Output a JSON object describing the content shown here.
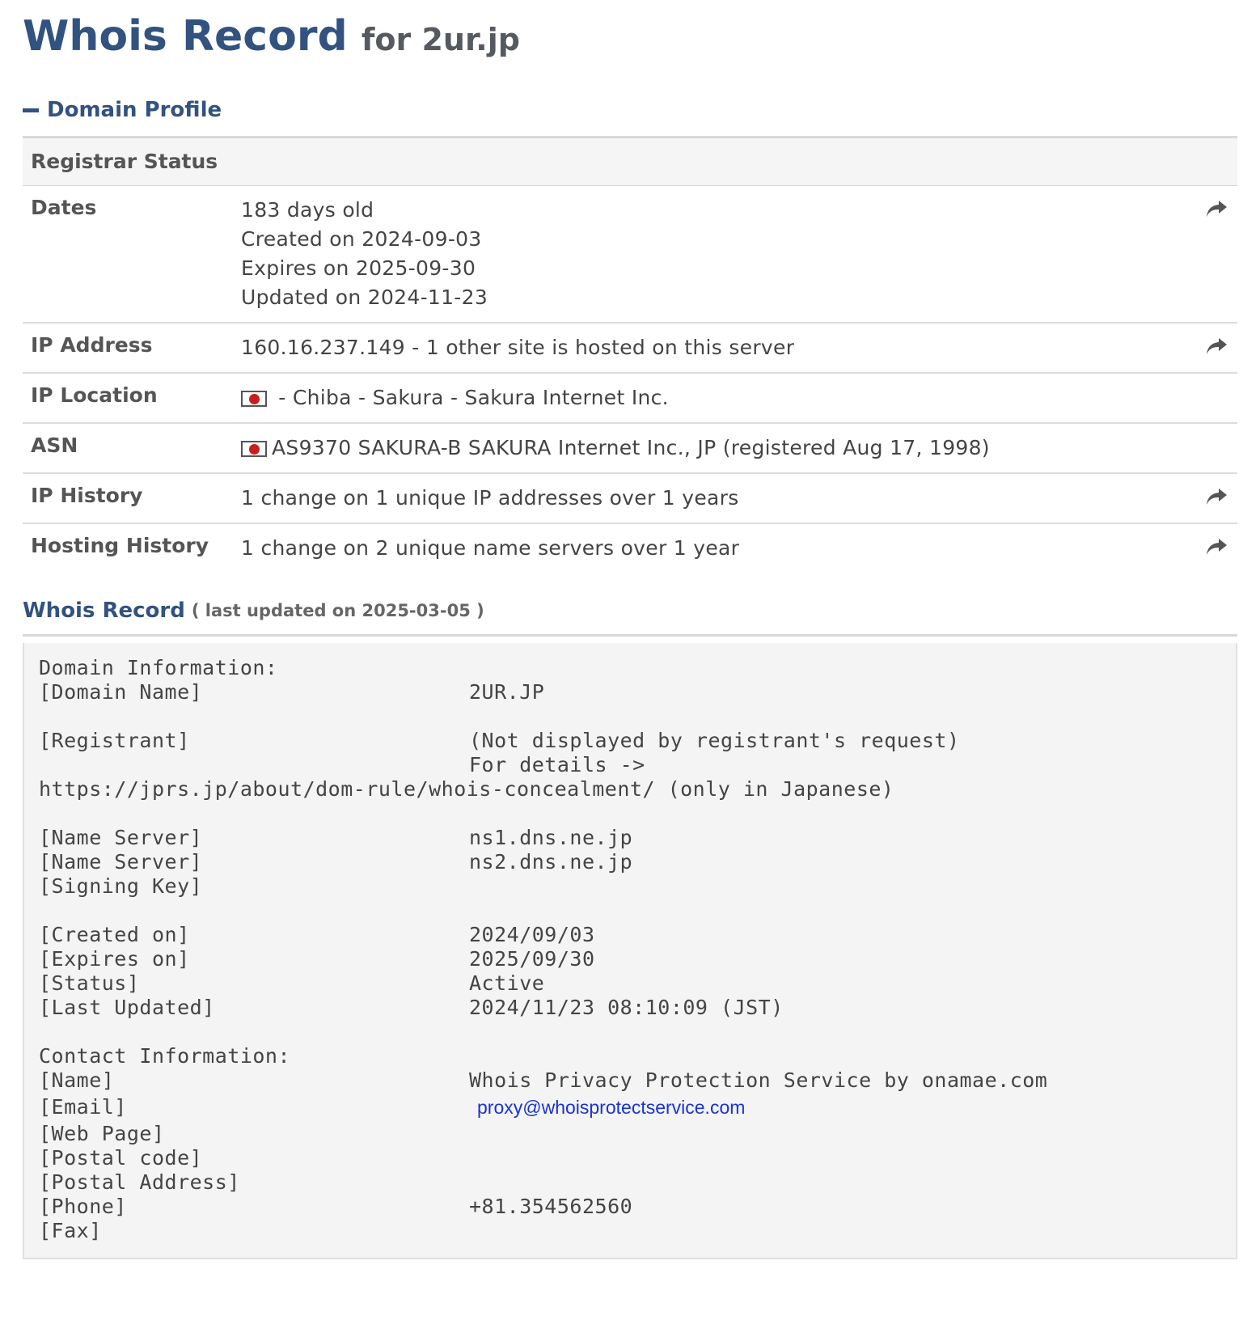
{
  "header": {
    "title": "Whois Record",
    "subtitle": "for 2ur.jp"
  },
  "profile": {
    "heading": "Domain Profile",
    "status_label": "Registrar Status",
    "dates": {
      "label": "Dates",
      "age": "183 days old",
      "created": "Created on 2024-09-03",
      "expires": "Expires on 2025-09-30",
      "updated": "Updated on 2024-11-23"
    },
    "ip_address": {
      "label": "IP Address",
      "value": "160.16.237.149 - 1 other site is hosted on this server"
    },
    "ip_location": {
      "label": "IP Location",
      "value": " - Chiba - Sakura - Sakura Internet Inc."
    },
    "asn": {
      "label": "ASN",
      "value": "AS9370 SAKURA-B SAKURA Internet Inc., JP (registered Aug 17, 1998)"
    },
    "ip_history": {
      "label": "IP History",
      "value": "1 change on 1 unique IP addresses over 1 years"
    },
    "hosting_history": {
      "label": "Hosting History",
      "value": "1 change on 2 unique name servers over 1 year"
    }
  },
  "record": {
    "title": "Whois Record",
    "updated": "( last updated on 2025-03-05 )",
    "domain_info_heading": "Domain Information:",
    "domain_name_key": "[Domain Name]",
    "domain_name_val": "2UR.JP",
    "registrant_key": "[Registrant]",
    "registrant_val": "(Not displayed by registrant's request)",
    "for_details": "For details ->",
    "concealment_url": "https://jprs.jp/about/dom-rule/whois-concealment/ (only in Japanese)",
    "ns1_key": "[Name Server]",
    "ns1_val": "ns1.dns.ne.jp",
    "ns2_key": "[Name Server]",
    "ns2_val": "ns2.dns.ne.jp",
    "signing_key": "[Signing Key]",
    "created_key": "[Created on]",
    "created_val": "2024/09/03",
    "expires_key": "[Expires on]",
    "expires_val": "2025/09/30",
    "status_key": "[Status]",
    "status_val": "Active",
    "last_updated_key": "[Last Updated]",
    "last_updated_val": "2024/11/23 08:10:09 (JST)",
    "contact_heading": "Contact Information:",
    "name_key": "[Name]",
    "name_val": "Whois Privacy Protection Service by onamae.com",
    "email_key": "[Email]",
    "email_val": "proxy@whoisprotectservice.com",
    "web_key": "[Web Page]",
    "postal_code_key": "[Postal code]",
    "postal_address_key": "[Postal Address]",
    "phone_key": "[Phone]",
    "phone_val": "+81.354562560",
    "fax_key": "[Fax]"
  },
  "icons": {
    "share": "share-arrow-icon",
    "flag": "japan-flag-icon",
    "collapse": "minus-icon"
  },
  "colors": {
    "accent": "#32527f",
    "link": "#1a32d6",
    "flag_red": "#c81e1e"
  }
}
